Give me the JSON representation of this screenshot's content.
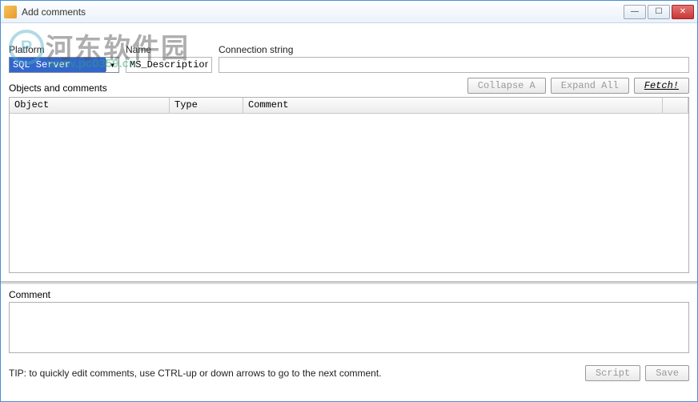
{
  "window": {
    "title": "Add comments"
  },
  "watermark": {
    "logo_letter": "P",
    "cn_text": "河东软件园",
    "url_text": "www.pc0359.cn"
  },
  "fields": {
    "platform_label": "Platform",
    "platform_value": "SQL Server",
    "name_label": "Name",
    "name_value": "MS_Description",
    "connection_label": "Connection string",
    "connection_value": ""
  },
  "objects_section": {
    "label": "Objects and comments",
    "buttons": {
      "collapse": "Collapse A",
      "expand": "Expand All",
      "fetch": "Fetch!"
    },
    "columns": {
      "object": "Object",
      "type": "Type",
      "comment": "Comment"
    },
    "rows": []
  },
  "comment_section": {
    "label": "Comment",
    "value": ""
  },
  "footer": {
    "tip": "TIP: to quickly edit comments, use CTRL-up or down arrows to go to the next comment.",
    "script_btn": "Script",
    "save_btn": "Save"
  }
}
